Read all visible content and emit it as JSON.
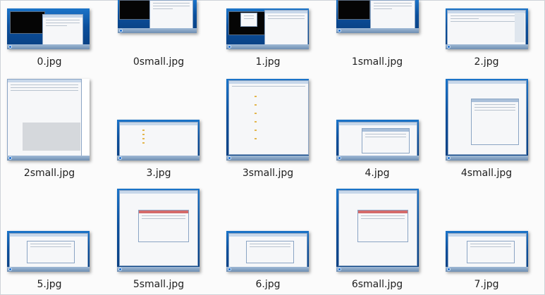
{
  "files": [
    {
      "name": "0.jpg"
    },
    {
      "name": "0small.jpg"
    },
    {
      "name": "1.jpg"
    },
    {
      "name": "1small.jpg"
    },
    {
      "name": "2.jpg"
    },
    {
      "name": "2small.jpg"
    },
    {
      "name": "3.jpg"
    },
    {
      "name": "3small.jpg"
    },
    {
      "name": "4.jpg"
    },
    {
      "name": "4small.jpg"
    },
    {
      "name": "5.jpg"
    },
    {
      "name": "5small.jpg"
    },
    {
      "name": "6.jpg"
    },
    {
      "name": "6small.jpg"
    },
    {
      "name": "7.jpg"
    }
  ]
}
